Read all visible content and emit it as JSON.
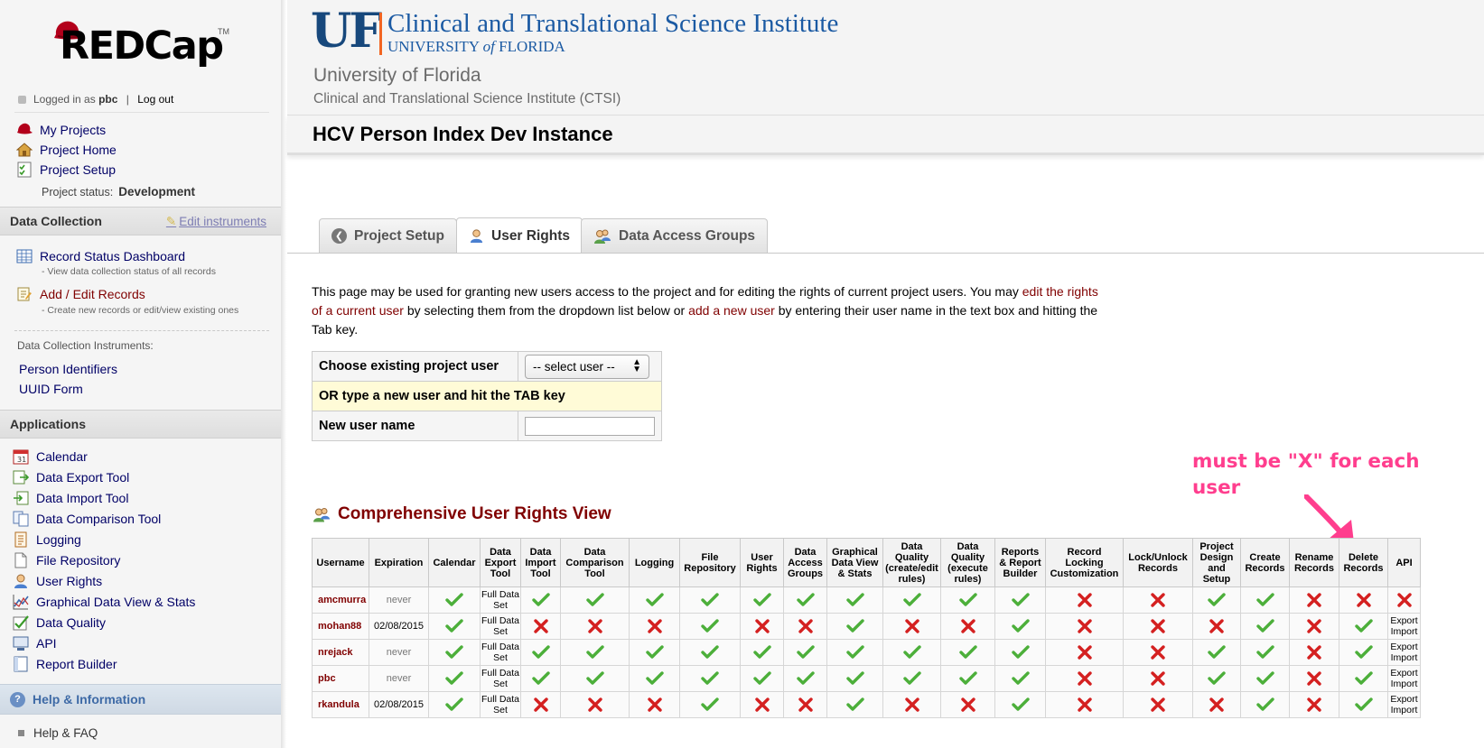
{
  "sidebar": {
    "logo_text": "REDCap",
    "logo_tm": "TM",
    "logged_in_prefix": "Logged in as",
    "username": "pbc",
    "separator": "|",
    "logout": "Log out",
    "nav": [
      {
        "label": "My Projects",
        "icon": "red-hat-icon"
      },
      {
        "label": "Project Home",
        "icon": "house-icon"
      },
      {
        "label": "Project Setup",
        "icon": "checklist-icon"
      }
    ],
    "status_label": "Project status:",
    "status_value": "Development",
    "data_collection": {
      "header": "Data Collection",
      "edit_instruments": "Edit instruments",
      "record_status_dashboard": "Record Status Dashboard",
      "record_status_desc": "- View data collection status of all records",
      "add_edit_records": "Add / Edit Records",
      "add_edit_desc": "- Create new records or edit/view existing ones",
      "instruments_label": "Data Collection Instruments:",
      "instruments": [
        "Person Identifiers",
        "UUID Form"
      ]
    },
    "applications": {
      "header": "Applications",
      "items": [
        {
          "label": "Calendar",
          "icon": "calendar-icon"
        },
        {
          "label": "Data Export Tool",
          "icon": "export-icon"
        },
        {
          "label": "Data Import Tool",
          "icon": "import-icon"
        },
        {
          "label": "Data Comparison Tool",
          "icon": "compare-icon"
        },
        {
          "label": "Logging",
          "icon": "logging-icon"
        },
        {
          "label": "File Repository",
          "icon": "file-icon"
        },
        {
          "label": "User Rights",
          "icon": "user-icon"
        },
        {
          "label": "Graphical Data View & Stats",
          "icon": "chart-icon"
        },
        {
          "label": "Data Quality",
          "icon": "data-quality-icon"
        },
        {
          "label": "API",
          "icon": "api-icon"
        },
        {
          "label": "Report Builder",
          "icon": "report-icon"
        }
      ]
    },
    "help": {
      "header": "Help & Information",
      "faq": "Help & FAQ"
    }
  },
  "header": {
    "uf_mark": "UF",
    "ctsi_title": "Clinical and Translational Science Institute",
    "ctsi_sub_pre": "UNIVERSITY",
    "ctsi_sub_of": "of",
    "ctsi_sub_post": "FLORIDA",
    "institution": "University of Florida",
    "institution_sub": "Clinical and Translational Science Institute (CTSI)",
    "project_title": "HCV Person Index Dev Instance"
  },
  "tabs": [
    {
      "label": "Project Setup",
      "active": false
    },
    {
      "label": "User Rights",
      "active": true
    },
    {
      "label": "Data Access Groups",
      "active": false
    }
  ],
  "intro": {
    "part1": "This page may be used for granting new users access to the project and for editing the rights of current project users. You may ",
    "link1": "edit the rights of a current user",
    "part2": " by selecting them from the dropdown list below or ",
    "link2": "add a new user",
    "part3": " by entering their user name in the text box and hitting the Tab key."
  },
  "user_form": {
    "choose_label": "Choose existing project user",
    "select_value": "-- select user --",
    "or_label": "OR type a new user and hit the TAB key",
    "new_user_label": "New user name",
    "new_user_value": ""
  },
  "annotation": "must be \"X\" for each user",
  "rights_view": {
    "title": "Comprehensive User Rights View",
    "columns": [
      "Username",
      "Expiration",
      "Calendar",
      "Data Export Tool",
      "Data Import Tool",
      "Data Comparison Tool",
      "Logging",
      "File Repository",
      "User Rights",
      "Data Access Groups",
      "Graphical Data View & Stats",
      "Data Quality (create/edit rules)",
      "Data Quality (execute rules)",
      "Reports & Report Builder",
      "Record Locking Customization",
      "Lock/Unlock Records",
      "Project Design and Setup",
      "Create Records",
      "Rename Records",
      "Delete Records",
      "API"
    ],
    "rows": [
      {
        "username": "amcmurra",
        "expiration": "never",
        "cells": [
          "check",
          "Full Data Set",
          "check",
          "check",
          "check",
          "check",
          "check",
          "check",
          "check",
          "check",
          "check",
          "check",
          "x",
          "x",
          "check",
          "check",
          "x",
          "x",
          "x"
        ]
      },
      {
        "username": "mohan88",
        "expiration": "02/08/2015",
        "cells": [
          "check",
          "Full Data Set",
          "x",
          "x",
          "x",
          "check",
          "x",
          "x",
          "check",
          "x",
          "x",
          "check",
          "x",
          "x",
          "x",
          "check",
          "x",
          "check",
          "Export Import"
        ]
      },
      {
        "username": "nrejack",
        "expiration": "never",
        "cells": [
          "check",
          "Full Data Set",
          "check",
          "check",
          "check",
          "check",
          "check",
          "check",
          "check",
          "check",
          "check",
          "check",
          "x",
          "x",
          "check",
          "check",
          "x",
          "check",
          "Export Import"
        ]
      },
      {
        "username": "pbc",
        "expiration": "never",
        "cells": [
          "check",
          "Full Data Set",
          "check",
          "check",
          "check",
          "check",
          "check",
          "check",
          "check",
          "check",
          "check",
          "check",
          "x",
          "x",
          "check",
          "check",
          "x",
          "check",
          "Export Import"
        ]
      },
      {
        "username": "rkandula",
        "expiration": "02/08/2015",
        "cells": [
          "check",
          "Full Data Set",
          "x",
          "x",
          "x",
          "check",
          "x",
          "x",
          "check",
          "x",
          "x",
          "check",
          "x",
          "x",
          "x",
          "check",
          "x",
          "check",
          "Export Import"
        ]
      }
    ]
  },
  "colors": {
    "link_dark_red": "#800000",
    "nav_blue": "#000066",
    "annotation_pink": "#ff3e8e",
    "check_green": "#4caf3a",
    "x_red": "#d42020"
  }
}
